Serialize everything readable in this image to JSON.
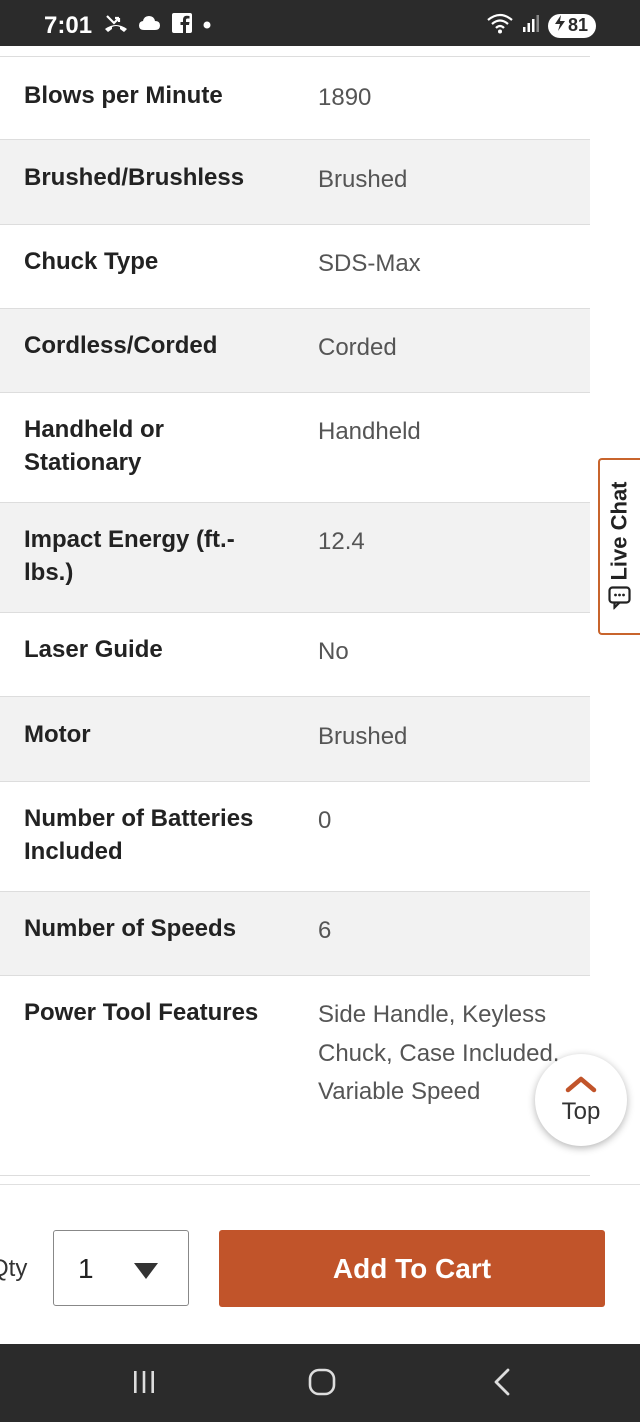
{
  "status_bar": {
    "time": "7:01",
    "battery": "81",
    "icons_left": [
      "missed-call-icon",
      "cloud-icon",
      "facebook-icon",
      "dot-icon"
    ],
    "icons_right": [
      "wifi-icon",
      "signal-icon",
      "battery-charging-icon"
    ]
  },
  "specs": [
    {
      "name": "Blows per Minute",
      "value": "1890"
    },
    {
      "name": "Brushed/Brushless",
      "value": "Brushed"
    },
    {
      "name": "Chuck Type",
      "value": "SDS-Max"
    },
    {
      "name": "Cordless/Corded",
      "value": "Corded"
    },
    {
      "name": "Handheld or Stationary",
      "value": "Handheld"
    },
    {
      "name": "Impact Energy (ft.-lbs.)",
      "value": "12.4"
    },
    {
      "name": "Laser Guide",
      "value": "No"
    },
    {
      "name": "Motor",
      "value": "Brushed"
    },
    {
      "name": "Number of Batteries Included",
      "value": "0"
    },
    {
      "name": "Number of Speeds",
      "value": "6"
    },
    {
      "name": "Power Tool Features",
      "value": "Side Handle, Keyless Chuck, Case Included, Variable Speed"
    }
  ],
  "live_chat": {
    "label": "Live Chat"
  },
  "top_button": {
    "label": "Top"
  },
  "cart": {
    "qty_label": "Qty",
    "qty_value": "1",
    "add_to_cart_label": "Add To Cart"
  },
  "colors": {
    "accent": "#c1542a",
    "live_chat_border": "#c8642c",
    "status_bar_bg": "#2b2b2b"
  }
}
